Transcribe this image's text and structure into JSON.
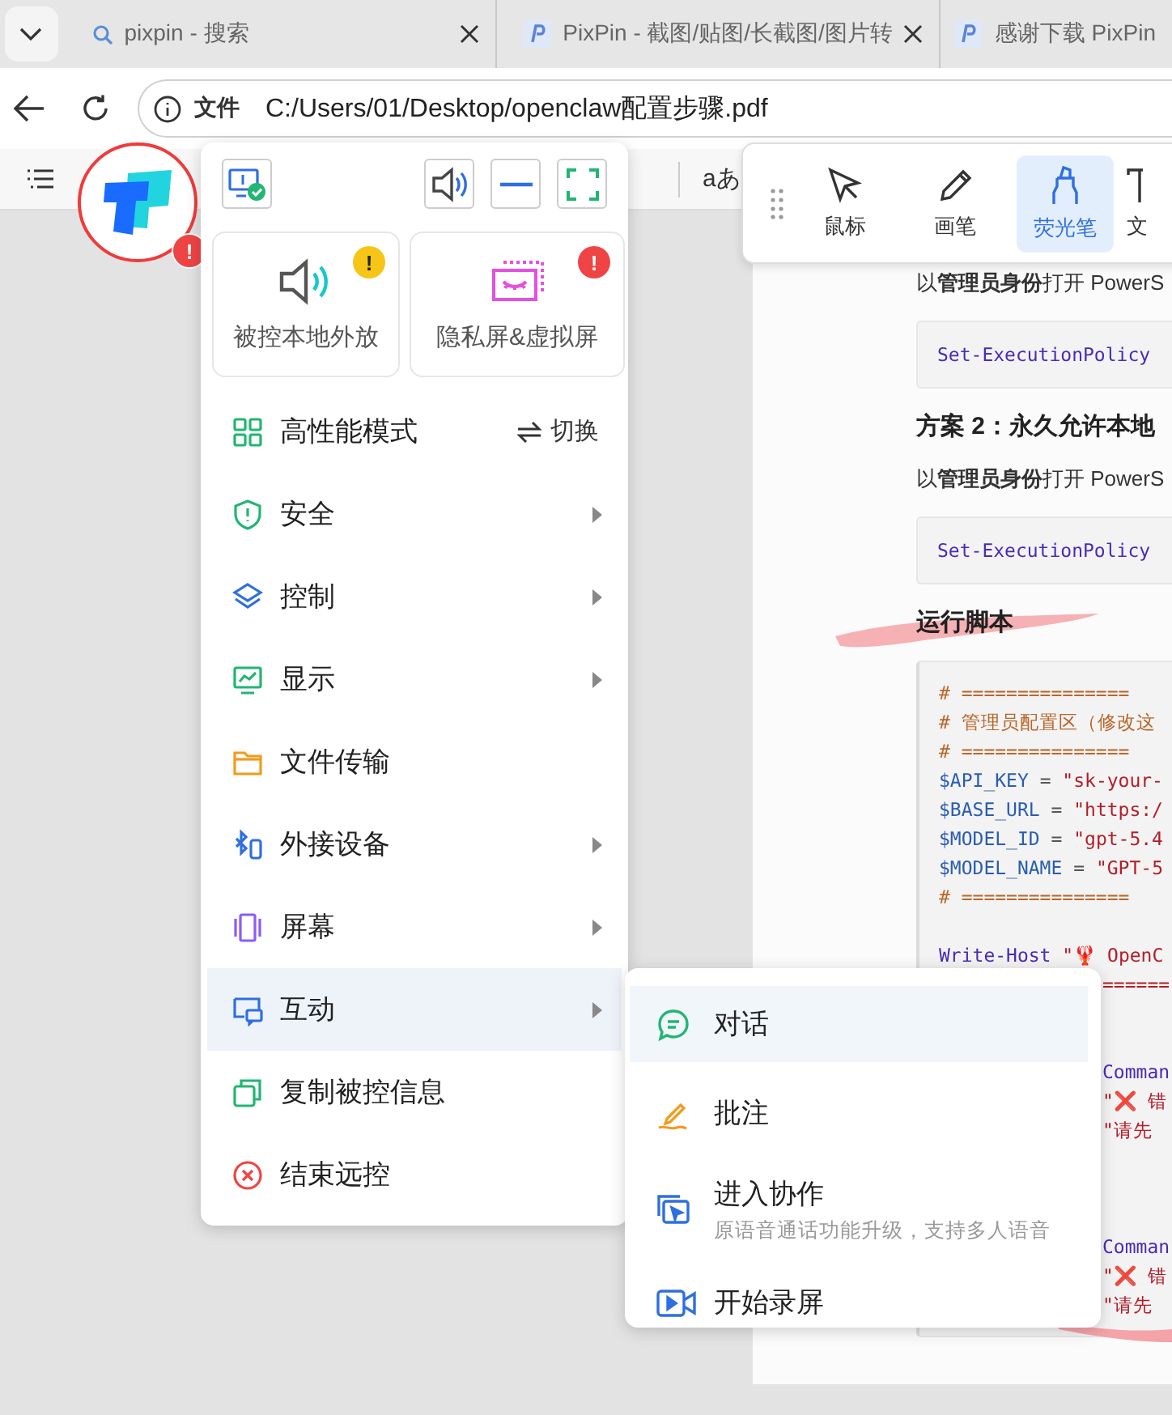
{
  "tab_bar": {
    "tabs": [
      {
        "title": "pixpin - 搜索",
        "kind": "search"
      },
      {
        "title": "PixPin - 截图/贴图/长截图/图片转",
        "kind": "site"
      },
      {
        "title": "感谢下载 PixPin",
        "kind": "site"
      }
    ]
  },
  "address_bar": {
    "scheme": "文件",
    "url": "C:/Users/01/Desktop/openclaw配置步骤.pdf"
  },
  "pdf_toolbar": {
    "text_tool": "aあ"
  },
  "annotation_toolbar": {
    "tools": [
      {
        "label": "鼠标",
        "selected": false
      },
      {
        "label": "画笔",
        "selected": false
      },
      {
        "label": "荧光笔",
        "selected": true
      },
      {
        "label": "文",
        "selected": false
      }
    ]
  },
  "document": {
    "blocks": [
      {
        "kind": "paragraph",
        "text": "以**管理员身份**打开 PowerS"
      },
      {
        "kind": "code",
        "lines": [
          {
            "kind": "text",
            "covered": false,
            "parts": [
              {
                "kind": "command",
                "text": "Set-ExecutionPolicy"
              }
            ]
          }
        ]
      },
      {
        "kind": "heading",
        "text": "方案 2：永久允许本地",
        "highlighted": false
      },
      {
        "kind": "paragraph",
        "text": "以**管理员身份**打开 PowerS"
      },
      {
        "kind": "code",
        "lines": [
          {
            "kind": "text",
            "covered": false,
            "parts": [
              {
                "kind": "command",
                "text": "Set-ExecutionPolicy"
              }
            ]
          }
        ]
      },
      {
        "kind": "heading",
        "text": "运行脚本",
        "highlighted": true
      },
      {
        "kind": "script",
        "lines": [
          {
            "kind": "text",
            "covered": false,
            "parts": [
              {
                "kind": "comment",
                "text": "# ==============="
              }
            ]
          },
          {
            "kind": "text",
            "covered": false,
            "parts": [
              {
                "kind": "comment",
                "text": "# 管理员配置区（修改这"
              }
            ]
          },
          {
            "kind": "text",
            "covered": false,
            "parts": [
              {
                "kind": "comment",
                "text": "# ==============="
              }
            ]
          },
          {
            "kind": "text",
            "covered": false,
            "parts": [
              {
                "kind": "variable",
                "text": "$API_KEY"
              },
              {
                "kind": "plain",
                "text": " = "
              },
              {
                "kind": "string",
                "text": "\"sk-your-"
              }
            ]
          },
          {
            "kind": "text",
            "covered": false,
            "parts": [
              {
                "kind": "variable",
                "text": "$BASE_URL"
              },
              {
                "kind": "plain",
                "text": " = "
              },
              {
                "kind": "string",
                "text": "\"https:/"
              }
            ]
          },
          {
            "kind": "text",
            "covered": false,
            "parts": [
              {
                "kind": "variable",
                "text": "$MODEL_ID"
              },
              {
                "kind": "plain",
                "text": " = "
              },
              {
                "kind": "string",
                "text": "\"gpt-5.4"
              }
            ]
          },
          {
            "kind": "text",
            "covered": false,
            "parts": [
              {
                "kind": "variable",
                "text": "$MODEL_NAME"
              },
              {
                "kind": "plain",
                "text": " = "
              },
              {
                "kind": "string",
                "text": "\"GPT-5"
              }
            ]
          },
          {
            "kind": "text",
            "covered": false,
            "parts": [
              {
                "kind": "comment",
                "text": "# ==============="
              }
            ]
          },
          {
            "kind": "blank"
          },
          {
            "kind": "text",
            "covered": false,
            "parts": [
              {
                "kind": "command",
                "text": "Write-Host"
              },
              {
                "kind": "string",
                "text": " \"🦞 OpenC"
              }
            ]
          },
          {
            "kind": "text",
            "covered": true,
            "parts": [
              {
                "kind": "string",
                "text": "======"
              }
            ]
          },
          {
            "kind": "blank"
          },
          {
            "kind": "blank"
          },
          {
            "kind": "text",
            "covered": true,
            "parts": [
              {
                "kind": "command",
                "text": "Comman"
              }
            ]
          },
          {
            "kind": "text",
            "covered": true,
            "parts": [
              {
                "kind": "string",
                "text": "\"❌ 错"
              }
            ]
          },
          {
            "kind": "text",
            "covered": true,
            "parts": [
              {
                "kind": "string",
                "text": "\"请先"
              }
            ]
          },
          {
            "kind": "blank"
          },
          {
            "kind": "blank"
          },
          {
            "kind": "blank"
          },
          {
            "kind": "text",
            "covered": true,
            "parts": [
              {
                "kind": "command",
                "text": "Comman"
              }
            ]
          },
          {
            "kind": "text",
            "covered": true,
            "parts": [
              {
                "kind": "string",
                "text": "\"❌ 错"
              }
            ]
          },
          {
            "kind": "text",
            "covered": true,
            "parts": [
              {
                "kind": "string",
                "text": "\"请先"
              }
            ]
          }
        ]
      }
    ]
  },
  "logo": {
    "badge": "!"
  },
  "control_menu": {
    "cards": [
      {
        "label": "被控本地外放",
        "badge": "!",
        "color": "#f5c518"
      },
      {
        "label": "隐私屏&虚拟屏",
        "badge": "!",
        "color": "#ef4444"
      }
    ],
    "items": [
      {
        "label": "高性能模式",
        "action": "切换",
        "has_submenu": false,
        "selected": false
      },
      {
        "label": "安全",
        "has_submenu": true,
        "selected": false
      },
      {
        "label": "控制",
        "has_submenu": true,
        "selected": false
      },
      {
        "label": "显示",
        "has_submenu": true,
        "selected": false
      },
      {
        "label": "文件传输",
        "has_submenu": false,
        "selected": false
      },
      {
        "label": "外接设备",
        "has_submenu": true,
        "selected": false
      },
      {
        "label": "屏幕",
        "has_submenu": true,
        "selected": false
      },
      {
        "label": "互动",
        "has_submenu": true,
        "selected": true
      },
      {
        "label": "复制被控信息",
        "has_submenu": false,
        "selected": false
      },
      {
        "label": "结束远控",
        "has_submenu": false,
        "selected": false
      }
    ]
  },
  "submenu": {
    "items": [
      {
        "label": "对话",
        "selected": true
      },
      {
        "label": "批注",
        "selected": false
      },
      {
        "label": "进入协作",
        "description": "原语音通话功能升级，支持多人语音",
        "selected": false
      },
      {
        "label": "开始录屏",
        "selected": false
      }
    ]
  }
}
